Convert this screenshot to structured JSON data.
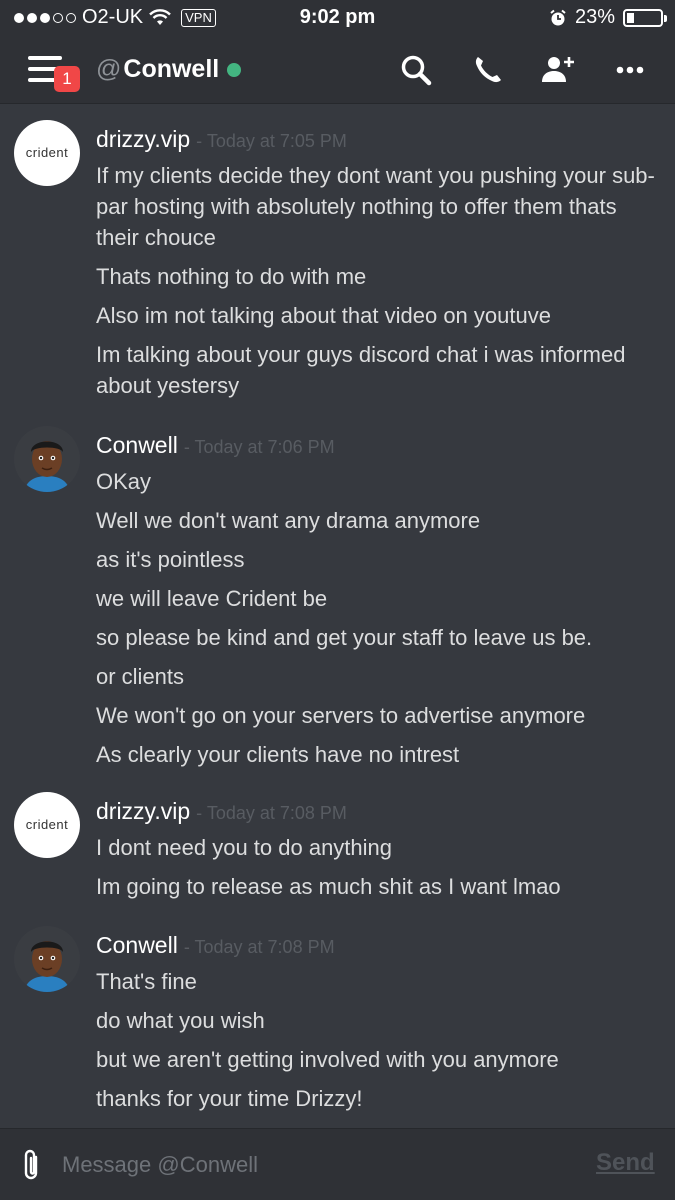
{
  "status_bar": {
    "carrier": "O2-UK",
    "vpn": "VPN",
    "time": "9:02 pm",
    "battery": "23%",
    "battery_level": 0.23
  },
  "header": {
    "at": "@",
    "channel_name": "Conwell",
    "notification_count": "1",
    "icons": [
      "menu-icon",
      "search-icon",
      "phone-icon",
      "add-friend-icon",
      "more-icon"
    ],
    "online_color": "#43b581"
  },
  "messages": [
    {
      "author": "drizzy.vip",
      "avatar_text": "crident",
      "timestamp": "- Today at 7:05 PM",
      "lines": [
        "If my clients decide they dont want you pushing your sub-par hosting with absolutely nothing to offer them thats their chouce",
        "Thats nothing to do with me",
        "Also im not talking about that video on youtuve",
        "Im talking about your guys discord chat i was informed about yestersy"
      ]
    },
    {
      "author": "Conwell",
      "avatar_text": "",
      "timestamp": "- Today at 7:06 PM",
      "lines": [
        "OKay",
        "Well we don't want any drama anymore",
        "as it's pointless",
        "we will leave Crident be",
        "so please be kind and get your staff to leave us be.",
        "or clients",
        "We won't go on your servers to advertise anymore",
        "As clearly your clients have no intrest"
      ]
    },
    {
      "author": "drizzy.vip",
      "avatar_text": "crident",
      "timestamp": "- Today at 7:08 PM",
      "lines": [
        "I dont need you to do anything",
        "Im going to release as much shit as I want lmao"
      ]
    },
    {
      "author": "Conwell",
      "avatar_text": "",
      "timestamp": "- Today at 7:08 PM",
      "lines": [
        "That's fine",
        "do what you wish",
        "but we aren't getting involved with you anymore",
        "thanks for your time Drizzy!"
      ]
    }
  ],
  "composer": {
    "placeholder": "Message @Conwell",
    "send_label": "Send"
  }
}
